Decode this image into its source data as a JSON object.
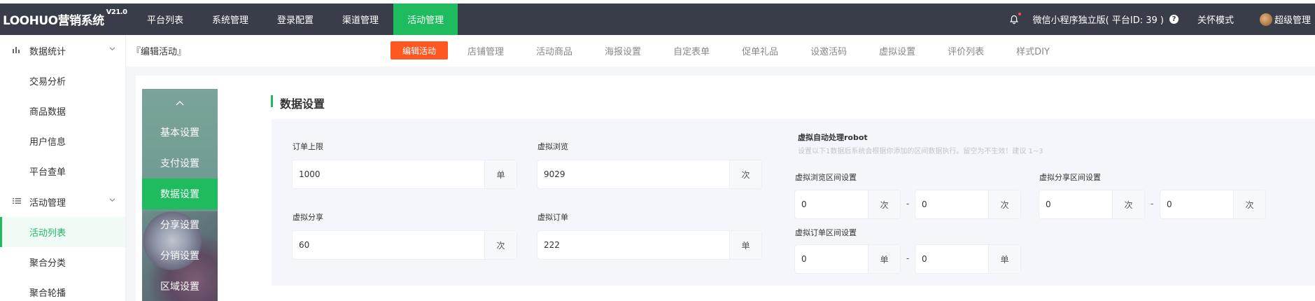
{
  "header": {
    "logo": "LOOHUO营销系统",
    "version": "V21.0",
    "nav": [
      "平台列表",
      "系统管理",
      "登录配置",
      "渠道管理",
      "活动管理"
    ],
    "active_nav": "活动管理",
    "platform": "微信小程序独立版( 平台ID: 39 )",
    "help_icon": "?",
    "care_mode": "关怀模式",
    "user": "超级管理"
  },
  "sidebar": {
    "groups": [
      {
        "label": "数据统计",
        "icon": "bar-chart-icon",
        "items": [
          "交易分析",
          "商品数据",
          "用户信息",
          "平台查单"
        ]
      },
      {
        "label": "活动管理",
        "icon": "list-icon",
        "items": [
          "活动列表",
          "聚合分类",
          "聚合轮播"
        ]
      }
    ],
    "active_item": "活动列表"
  },
  "breadcrumb": "『编辑活动』",
  "tabs": [
    "编辑活动",
    "店铺管理",
    "活动商品",
    "海报设置",
    "自定表单",
    "促单礼品",
    "设邀活码",
    "虚拟设置",
    "评价列表",
    "样式DIY"
  ],
  "active_tab": "编辑活动",
  "vertical_menu": {
    "items": [
      "基本设置",
      "支付设置",
      "数据设置",
      "分享设置",
      "分销设置",
      "区域设置"
    ],
    "active": "数据设置"
  },
  "section_title": "数据设置",
  "form": {
    "order_limit": {
      "label": "订单上限",
      "value": "1000",
      "unit": "单"
    },
    "virtual_views": {
      "label": "虚拟浏览",
      "value": "9029",
      "unit": "次"
    },
    "virtual_shares": {
      "label": "虚拟分享",
      "value": "60",
      "unit": "次"
    },
    "virtual_orders": {
      "label": "虚拟订单",
      "value": "222",
      "unit": "单"
    }
  },
  "robot": {
    "title": "虚拟自动处理robot",
    "desc": "设置以下1数据后系统会根据你添加的区间数据执行。留空为不生效！建议 1~3",
    "views_range": {
      "label": "虚拟浏览区间设置",
      "min": "0",
      "max": "0",
      "unit": "次"
    },
    "shares_range": {
      "label": "虚拟分享区间设置",
      "min": "0",
      "max": "0",
      "unit": "次"
    },
    "orders_range": {
      "label": "虚拟订单区间设置",
      "min": "0",
      "max": "0",
      "unit": "单"
    },
    "separator": "-"
  },
  "colors": {
    "topbar": "#393d49",
    "accent": "#1fbc5f",
    "active_tab": "#ff5722"
  }
}
